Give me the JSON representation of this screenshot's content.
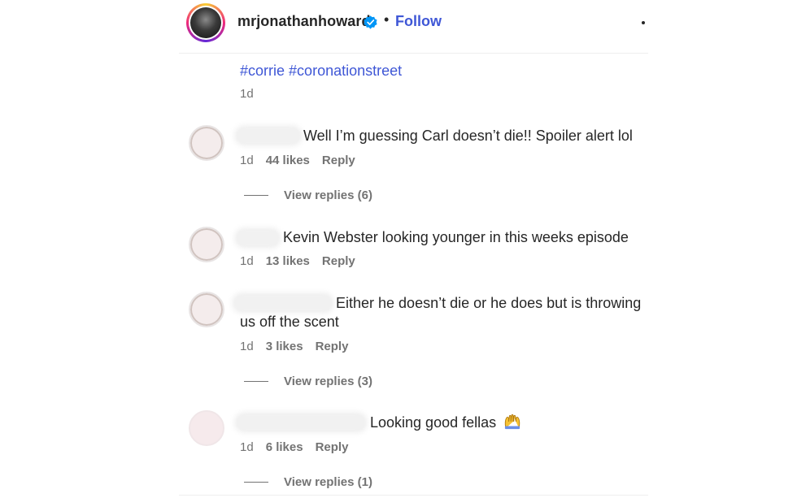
{
  "post_header": {
    "username": "mrjonathanhoward",
    "follow_label": "Follow",
    "separator": "•",
    "verified_icon": "verified-badge-icon",
    "more_icon": "more-options-icon"
  },
  "caption": {
    "hashtags": [
      "#corrie",
      "#coronationstreet"
    ],
    "time": "1d"
  },
  "comments": [
    {
      "text": "Well I’m guessing Carl doesn’t die!! Spoiler alert lol",
      "time": "1d",
      "likes": "44 likes",
      "reply_label": "Reply",
      "view_replies": "View replies (6)"
    },
    {
      "text": "Kevin Webster looking younger in this weeks episode",
      "time": "1d",
      "likes": "13 likes",
      "reply_label": "Reply"
    },
    {
      "text_line1": "Either he doesn’t die or he does but is throwing",
      "text_line2": "us off the scent",
      "time": "1d",
      "likes": "3 likes",
      "reply_label": "Reply",
      "view_replies": "View replies (3)"
    },
    {
      "text": "Looking good fellas",
      "emoji_icon": "raising-hands-emoji-icon",
      "time": "1d",
      "likes": "6 likes",
      "reply_label": "Reply",
      "view_replies": "View replies (1)"
    }
  ],
  "colors": {
    "link": "#3f57d6",
    "secondary_text": "#737373",
    "primary_text": "#262626",
    "verified": "#0095f6"
  }
}
